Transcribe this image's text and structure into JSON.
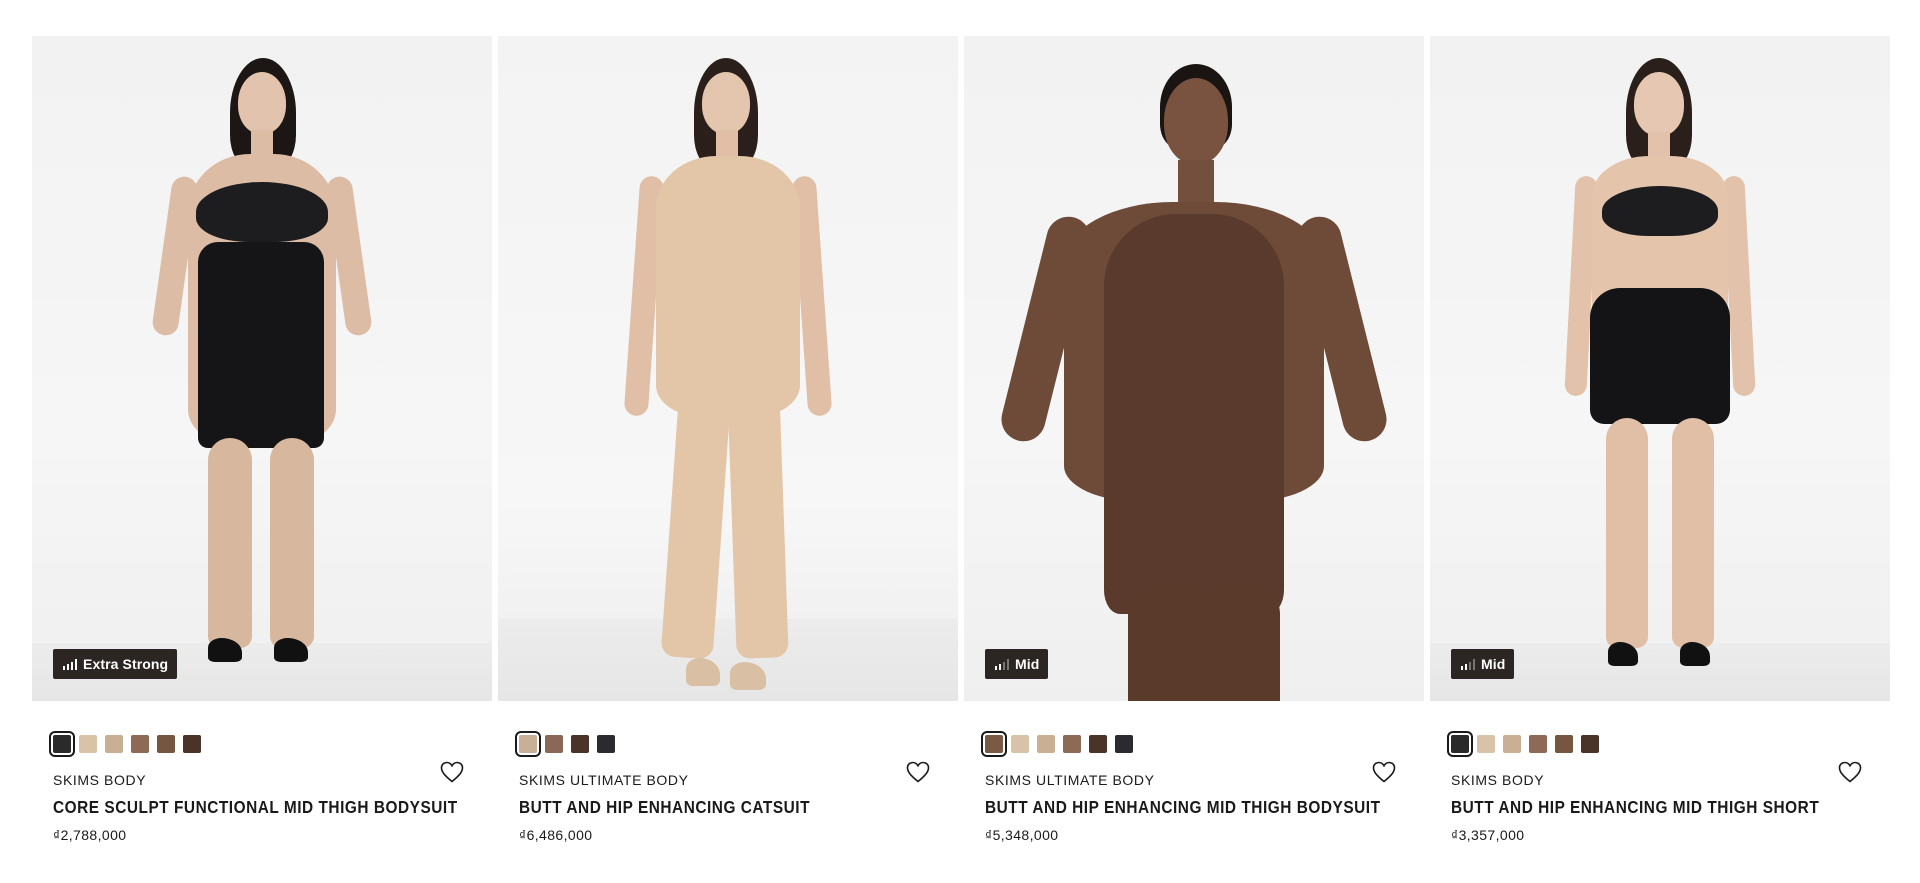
{
  "products": [
    {
      "badge": "Extra Strong",
      "badge_level": 4,
      "brand": "SKIMS BODY",
      "name": "CORE SCULPT FUNCTIONAL MID THIGH BODYSUIT",
      "price": "₫2,788,000",
      "swatches": [
        "#2a2a2a",
        "#d8c2a8",
        "#c9b095",
        "#8d6a55",
        "#75563f",
        "#4a3328"
      ],
      "selected_swatch": 0
    },
    {
      "badge": "",
      "badge_level": 0,
      "brand": "SKIMS ULTIMATE BODY",
      "name": "BUTT AND HIP ENHANCING CATSUIT",
      "price": "₫6,486,000",
      "swatches": [
        "#c8b096",
        "#8a6757",
        "#4a3328",
        "#2b2b2f"
      ],
      "selected_swatch": 0
    },
    {
      "badge": "Mid",
      "badge_level": 2,
      "brand": "SKIMS ULTIMATE BODY",
      "name": "BUTT AND HIP ENHANCING MID THIGH BODYSUIT",
      "price": "₫5,348,000",
      "swatches": [
        "#7a5a43",
        "#d8c2a8",
        "#c9b095",
        "#8d6a55",
        "#4a3328",
        "#2b2b2f"
      ],
      "selected_swatch": 0
    },
    {
      "badge": "Mid",
      "badge_level": 2,
      "brand": "SKIMS BODY",
      "name": "BUTT AND HIP ENHANCING MID THIGH SHORT",
      "price": "₫3,357,000",
      "swatches": [
        "#2a2a2a",
        "#d8c2a8",
        "#c9b095",
        "#8d6a55",
        "#75563f",
        "#4a3328"
      ],
      "selected_swatch": 0
    }
  ],
  "icons": {
    "favorite": "heart-icon",
    "strength": "signal-bars-icon"
  }
}
